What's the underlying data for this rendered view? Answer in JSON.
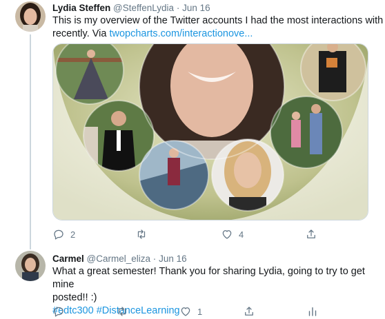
{
  "tweets": [
    {
      "name": "Lydia Steffen",
      "handle": "@SteffenLydia",
      "separator": "·",
      "time": "Jun 16",
      "text_line1": "This is my overview of the Twitter accounts I had the most interactions with",
      "text_prefix": "recently. Via ",
      "link": "twopcharts.com/interactionove...",
      "replies": "2",
      "retweets": "",
      "likes": "4"
    },
    {
      "name": "Carmel",
      "handle": "@Carmel_eliza",
      "separator": "·",
      "time": "Jun 16",
      "text_line1": "What a great semester! Thank you for sharing Lydia, going to try to get mine",
      "text_line2": "posted!! :)",
      "hashtags": "#edtc300 #DistanceLearning",
      "replies": "",
      "retweets": "",
      "likes": "1"
    }
  ],
  "icons": {
    "reply": "reply-icon",
    "retweet": "retweet-icon",
    "like": "heart-icon",
    "share": "share-icon",
    "analytics": "analytics-icon"
  },
  "colors": {
    "link": "#1b95e0",
    "secondary_text": "#657786",
    "thread_line": "#ccd6dd"
  }
}
